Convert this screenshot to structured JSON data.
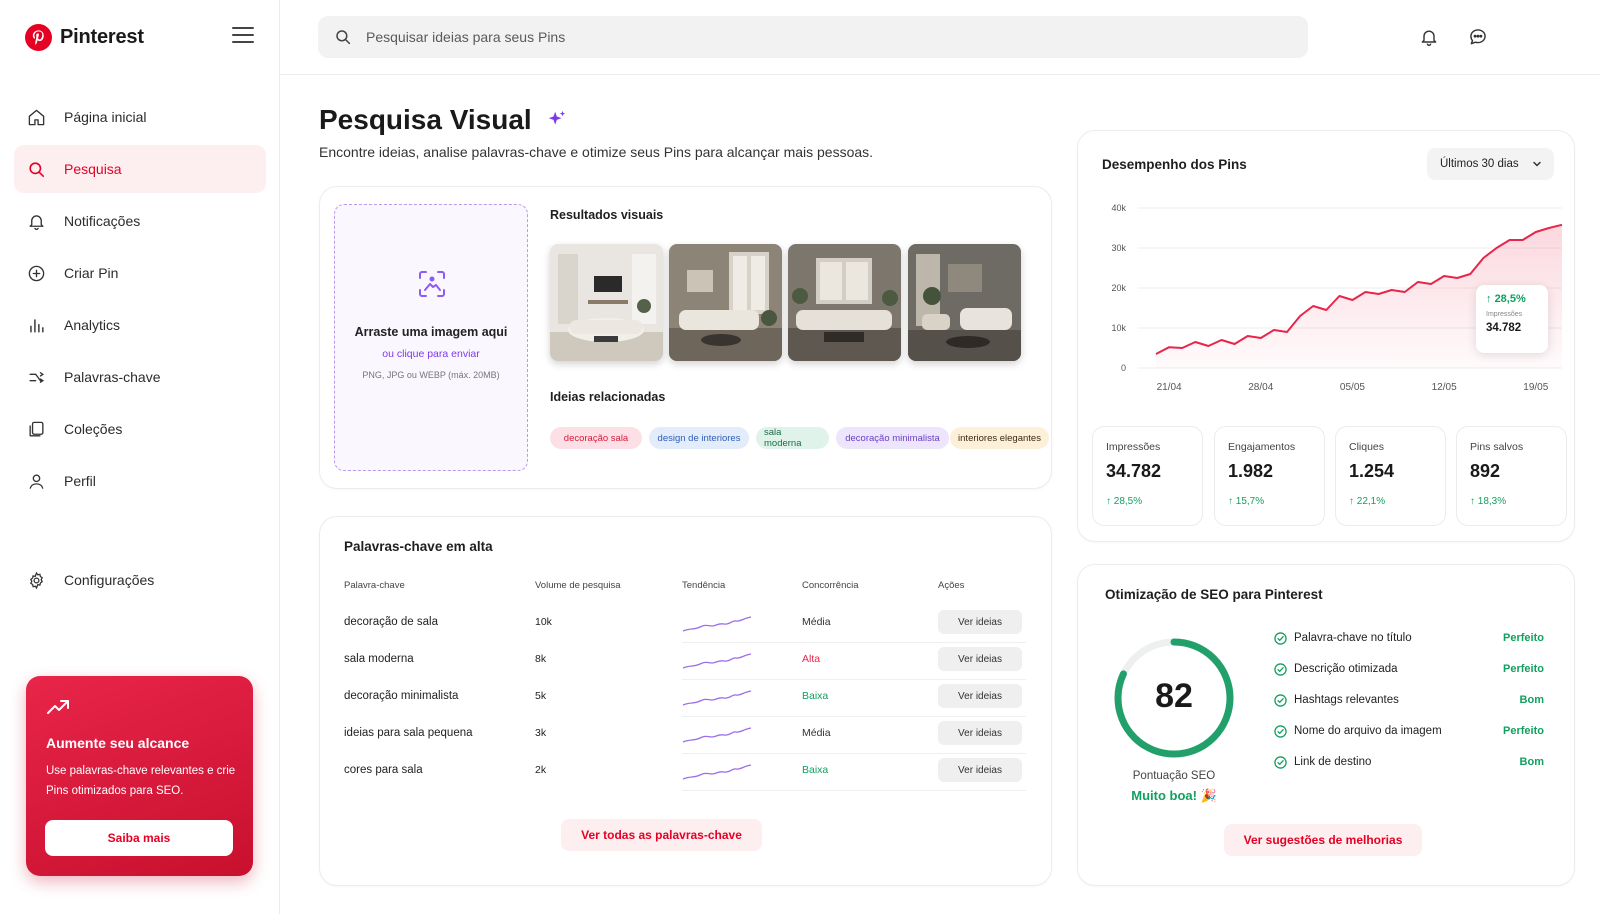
{
  "app": {
    "name": "Pinterest"
  },
  "sidebar": {
    "items": [
      {
        "label": "Página inicial",
        "icon": "home-icon"
      },
      {
        "label": "Pesquisa",
        "icon": "search-icon",
        "active": true
      },
      {
        "label": "Notificações",
        "icon": "bell-icon"
      },
      {
        "label": "Criar Pin",
        "icon": "plus-circle-icon"
      },
      {
        "label": "Analytics",
        "icon": "bar-chart-icon"
      },
      {
        "label": "Palavras-chave",
        "icon": "keywords-icon"
      },
      {
        "label": "Coleções",
        "icon": "collections-icon"
      },
      {
        "label": "Perfil",
        "icon": "user-icon"
      }
    ],
    "settings_label": "Configurações",
    "promo": {
      "title": "Aumente seu alcance",
      "text": "Use palavras-chave relevantes e crie Pins otimizados para SEO.",
      "button": "Saiba mais"
    }
  },
  "header": {
    "search_placeholder": "Pesquisar ideias para seus Pins"
  },
  "page": {
    "title": "Pesquisa Visual",
    "subtitle": "Encontre ideias, analise palavras-chave e otimize seus Pins para alcançar mais pessoas."
  },
  "visual_search": {
    "drop_title": "Arraste uma imagem aqui",
    "drop_prefix": "ou ",
    "drop_link": "clique para enviar",
    "drop_hint": "PNG, JPG ou WEBP (máx. 20MB)",
    "results_label": "Resultados visuais",
    "related_label": "Ideias relacionadas",
    "tags": [
      {
        "label": "decoração sala",
        "bg": "#fde0e5",
        "color": "#d81b3c"
      },
      {
        "label": "design de interiores",
        "bg": "#e3ecfb",
        "color": "#2f5fb8"
      },
      {
        "label": "sala moderna",
        "bg": "#dff3ea",
        "color": "#1d6d4a"
      },
      {
        "label": "decoração minimalista",
        "bg": "#ece5fb",
        "color": "#6b3fc8"
      },
      {
        "label": "interiores elegantes",
        "bg": "#fdf0d9",
        "color": "#3a2a10"
      }
    ]
  },
  "keywords": {
    "title": "Palavras-chave em alta",
    "headers": [
      "Palavra-chave",
      "Volume de pesquisa",
      "Tendência",
      "Concorrência",
      "Ações"
    ],
    "rows": [
      {
        "keyword": "decoração de sala",
        "volume": "10k",
        "competition": "Média",
        "level": "mid",
        "action": "Ver ideias"
      },
      {
        "keyword": "sala moderna",
        "volume": "8k",
        "competition": "Alta",
        "level": "high",
        "action": "Ver ideias"
      },
      {
        "keyword": "decoração minimalista",
        "volume": "5k",
        "competition": "Baixa",
        "level": "low",
        "action": "Ver ideias"
      },
      {
        "keyword": "ideias para sala pequena",
        "volume": "3k",
        "competition": "Média",
        "level": "mid",
        "action": "Ver ideias"
      },
      {
        "keyword": "cores para sala",
        "volume": "2k",
        "competition": "Baixa",
        "level": "low",
        "action": "Ver ideias"
      }
    ],
    "view_all": "Ver todas as palavras-chave"
  },
  "performance": {
    "title": "Desempenho dos Pins",
    "range": "Últimos 30 dias",
    "tooltip": {
      "delta": "28,5%",
      "label": "Impressões",
      "value": "34.782"
    },
    "stats": [
      {
        "label": "Impressões",
        "value": "34.782",
        "delta": "28,5%"
      },
      {
        "label": "Engajamentos",
        "value": "1.982",
        "delta": "15,7%"
      },
      {
        "label": "Cliques",
        "value": "1.254",
        "delta": "22,1%"
      },
      {
        "label": "Pins salvos",
        "value": "892",
        "delta": "18,3%"
      }
    ]
  },
  "chart_data": {
    "type": "area",
    "title": "",
    "xlabel": "",
    "ylabel": "",
    "y_ticks": [
      "0",
      "10k",
      "20k",
      "30k",
      "40k"
    ],
    "x_ticks": [
      "21/04",
      "28/04",
      "05/05",
      "12/05",
      "19/05"
    ],
    "ylim": [
      0,
      40000
    ],
    "x": [
      "20/04",
      "21/04",
      "22/04",
      "23/04",
      "24/04",
      "25/04",
      "26/04",
      "27/04",
      "28/04",
      "29/04",
      "30/04",
      "01/05",
      "02/05",
      "03/05",
      "04/05",
      "05/05",
      "06/05",
      "07/05",
      "08/05",
      "09/05",
      "10/05",
      "11/05",
      "12/05",
      "13/05",
      "14/05",
      "15/05",
      "16/05",
      "17/05",
      "18/05",
      "19/05",
      "20/05",
      "21/05"
    ],
    "values": [
      3500,
      5200,
      5000,
      6500,
      5500,
      7000,
      6000,
      8000,
      7500,
      9500,
      9000,
      13000,
      15500,
      14500,
      18000,
      17000,
      19000,
      18500,
      19500,
      19000,
      21500,
      21000,
      23000,
      22500,
      23500,
      27500,
      30000,
      32000,
      32000,
      34000,
      35000,
      35800
    ],
    "color": "#e8254a",
    "grid": true
  },
  "seo": {
    "title": "Otimização de SEO para Pinterest",
    "score": "82",
    "score_value": 82,
    "score_label": "Pontuação SEO",
    "score_verdict": "Muito boa! 🎉",
    "checks": [
      {
        "label": "Palavra-chave no título",
        "status": "Perfeito"
      },
      {
        "label": "Descrição otimizada",
        "status": "Perfeito"
      },
      {
        "label": "Hashtags relevantes",
        "status": "Bom"
      },
      {
        "label": "Nome do arquivo da imagem",
        "status": "Perfeito"
      },
      {
        "label": "Link de destino",
        "status": "Bom"
      }
    ],
    "button": "Ver sugestões de melhorias"
  },
  "colors": {
    "brand": "#e60023",
    "accent_purple": "#7c3aed",
    "positive": "#13a05f",
    "negative": "#e8254a"
  }
}
